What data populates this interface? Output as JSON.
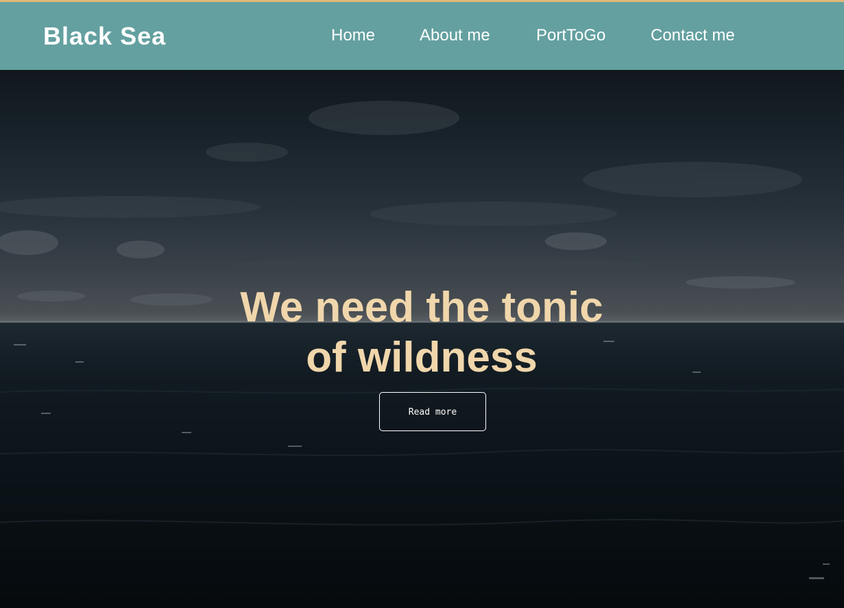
{
  "navbar": {
    "brand": "Black Sea",
    "links": [
      {
        "label": "Home"
      },
      {
        "label": "About me"
      },
      {
        "label": "PortToGo"
      },
      {
        "label": "Contact me"
      }
    ]
  },
  "hero": {
    "headline_line1": "We need the tonic",
    "headline_line2": "of wildness",
    "button_label": "Read more"
  },
  "colors": {
    "navbar_bg": "#64a0a0",
    "headline": "#f0d6ab",
    "top_accent_line": "#e0b878",
    "nav_text": "#ffffff"
  }
}
